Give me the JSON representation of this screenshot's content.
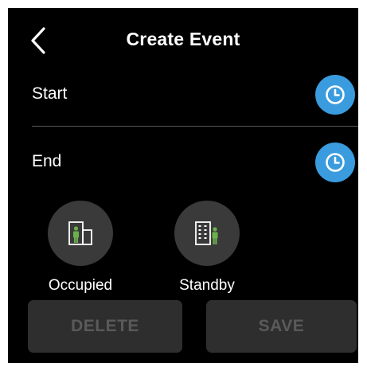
{
  "header": {
    "title": "Create Event",
    "back_icon": "chevron-left-icon"
  },
  "start": {
    "label": "Start",
    "icon": "clock-icon"
  },
  "end": {
    "label": "End",
    "icon": "clock-icon"
  },
  "modes": [
    {
      "label": "Occupied",
      "icon": "occupied-building-icon"
    },
    {
      "label": "Standby",
      "icon": "standby-building-icon"
    }
  ],
  "actions": {
    "delete_label": "DELETE",
    "save_label": "SAVE"
  },
  "colors": {
    "background": "#000000",
    "accent_blue": "#3a9cde",
    "person_green": "#6ab04c",
    "button_disabled_bg": "#2e2e2e",
    "button_disabled_text": "#5a5a5a",
    "mode_circle_bg": "#3a3a3a"
  }
}
